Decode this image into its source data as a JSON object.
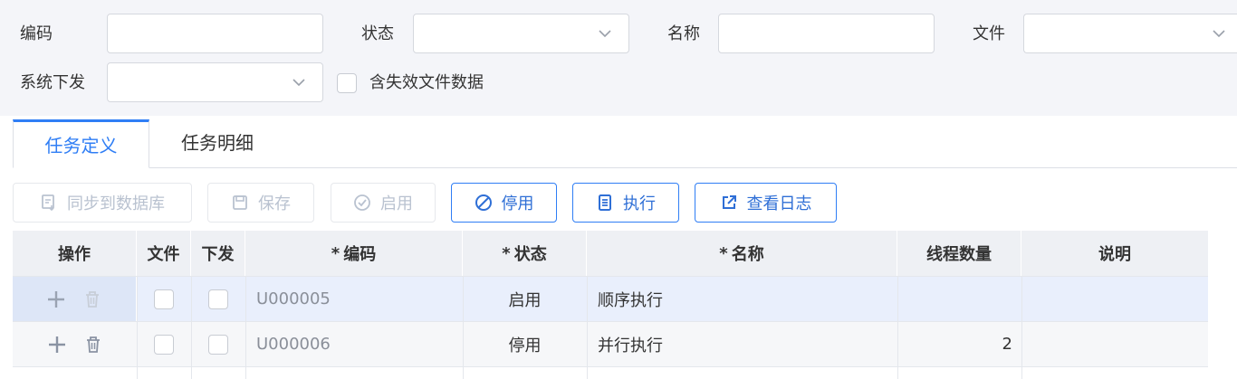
{
  "filters": {
    "code_label": "编码",
    "code_value": "",
    "status_label": "状态",
    "status_value": "",
    "name_label": "名称",
    "name_value": "",
    "file_label": "文件",
    "file_value": "",
    "system_label": "系统下发",
    "system_value": "",
    "include_invalid_label": "含失效文件数据",
    "include_invalid_checked": false
  },
  "tabs": [
    {
      "label": "任务定义",
      "active": true
    },
    {
      "label": "任务明细",
      "active": false
    }
  ],
  "toolbar": {
    "sync": {
      "label": "同步到数据库",
      "icon": "sync-icon",
      "enabled": false
    },
    "save": {
      "label": "保存",
      "icon": "save-icon",
      "enabled": false
    },
    "enable": {
      "label": "启用",
      "icon": "check-circle-icon",
      "enabled": false
    },
    "disable": {
      "label": "停用",
      "icon": "ban-icon",
      "enabled": true
    },
    "execute": {
      "label": "执行",
      "icon": "document-icon",
      "enabled": true
    },
    "view_log": {
      "label": "查看日志",
      "icon": "external-link-icon",
      "enabled": true
    }
  },
  "table": {
    "columns": {
      "ops": "操作",
      "file": "文件",
      "dispatch": "下发",
      "code": "编码",
      "status": "状态",
      "name": "名称",
      "threads": "线程数量",
      "desc": "说明"
    },
    "required_mark": "*",
    "rows": [
      {
        "file": false,
        "dispatch": false,
        "code": "U000005",
        "status": "启用",
        "name": "顺序执行",
        "threads": "",
        "desc": ""
      },
      {
        "file": false,
        "dispatch": false,
        "code": "U000006",
        "status": "停用",
        "name": "并行执行",
        "threads": "2",
        "desc": ""
      }
    ]
  },
  "colors": {
    "accent": "#2f7ef5",
    "filter_bg": "#f4f5f9",
    "header_bg": "#eef0f4",
    "selected_row_bg": "#e9effc"
  }
}
